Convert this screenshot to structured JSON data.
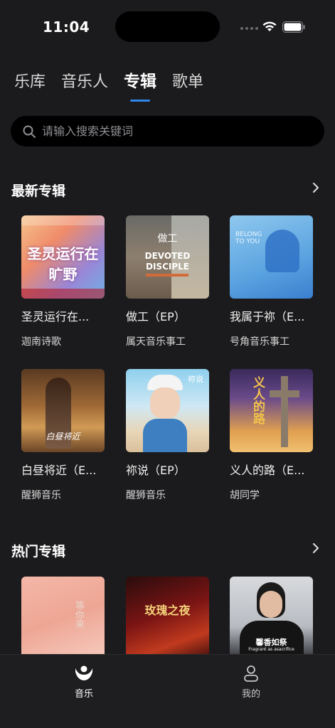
{
  "status": {
    "time": "11:04"
  },
  "tabs": [
    {
      "label": "乐库",
      "active": false
    },
    {
      "label": "音乐人",
      "active": false
    },
    {
      "label": "专辑",
      "active": true
    },
    {
      "label": "歌单",
      "active": false
    }
  ],
  "search": {
    "placeholder": "请输入搜索关键词"
  },
  "sections": {
    "latest": {
      "title": "最新专辑",
      "albums": [
        {
          "title": "圣灵运行在...",
          "artist": "迦南诗歌",
          "cover_text": "圣灵运行在旷野"
        },
        {
          "title": "做工（EP）",
          "artist": "属天音乐事工",
          "cover_text_top": "做工",
          "cover_text_main": "DEVOTED DISCIPLE"
        },
        {
          "title": "我属于祢（E...",
          "artist": "号角音乐事工",
          "cover_text": "BELONG TO YOU"
        },
        {
          "title": "白昼将近（E...",
          "artist": "醒狮音乐",
          "cover_text": "白昼将近"
        },
        {
          "title": "祢说（EP）",
          "artist": "醒狮音乐",
          "cover_text": "祢说"
        },
        {
          "title": "义人的路（E...",
          "artist": "胡同学",
          "cover_text": "义人的路"
        }
      ]
    },
    "hot": {
      "title": "热门专辑",
      "albums": [
        {
          "cover_text": "等你来"
        },
        {
          "cover_text": "玫瑰之夜"
        },
        {
          "cover_text": "馨香如祭",
          "cover_sub": "Fragrant as asacrifice"
        }
      ]
    }
  },
  "bottom_nav": [
    {
      "label": "音乐",
      "icon": "music-person-icon",
      "active": true
    },
    {
      "label": "我的",
      "icon": "profile-icon",
      "active": false
    }
  ],
  "colors": {
    "accent": "#2f86e8",
    "background": "#1b1b1d"
  }
}
